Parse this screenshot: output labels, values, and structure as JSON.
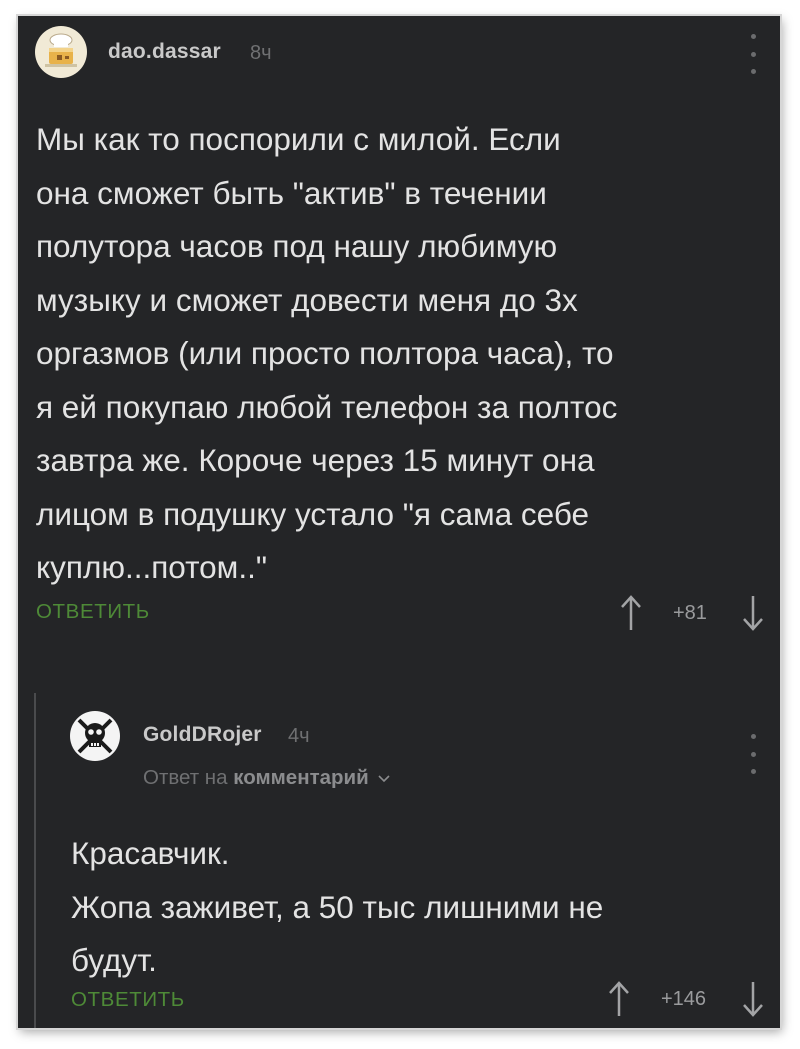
{
  "comments": [
    {
      "username": "dao.dassar",
      "time": "8ч",
      "text": "Мы как то поспорили с милой. Если\nона сможет быть \"актив\" в течении\nполутора часов под нашу любимую\nмузыку и сможет довести меня до 3х\nоргазмов (или просто полтора часа), то\nя ей покупаю любой телефон за полтос\nзавтра же. Короче через 15 минут она\nлицом в подушку устало \"я сама себе\nкуплю...потом..\"",
      "reply_label": "ОТВЕТИТЬ",
      "rating": "+81",
      "avatar_icon": "cake-icon"
    },
    {
      "username": "GoldDRojer",
      "time": "4ч",
      "reply_to_prefix": "Ответ на",
      "reply_to_link": "комментарий",
      "text": "Красавчик.\nЖопа заживет, а 50 тыс лишними не\nбудут.",
      "reply_label": "ОТВЕТИТЬ",
      "rating": "+146",
      "avatar_icon": "pirate-skull-icon"
    }
  ],
  "colors": {
    "background": "#242527",
    "text": "#e3e3e3",
    "reply_green": "#4e8a37",
    "muted": "#6f7072"
  }
}
